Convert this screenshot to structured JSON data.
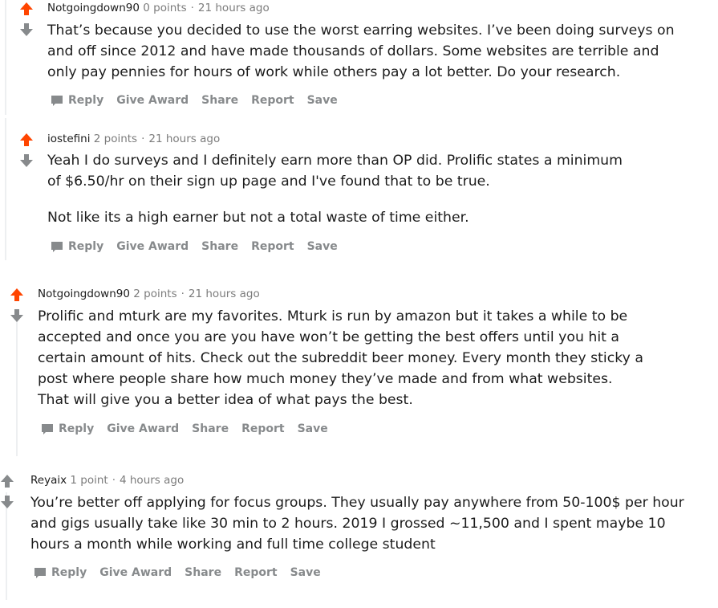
{
  "colors": {
    "upvote_active": "#ff4500",
    "vote_inactive": "#878a8c",
    "meta_text": "#7c7c7c",
    "action_text": "#878a8c"
  },
  "icons": {
    "upvote": "arrow-up-icon",
    "downvote": "arrow-down-icon",
    "reply": "speech-bubble-icon"
  },
  "actions": {
    "reply": "Reply",
    "give_award": "Give Award",
    "share": "Share",
    "report": "Report",
    "save": "Save"
  },
  "comments": [
    {
      "author": "Notgoingdown90",
      "points": "0 points",
      "sep": "·",
      "time": "21 hours ago",
      "upvoted": true,
      "paragraphs": [
        "That’s because you decided to use the worst earring websites. I’ve been doing surveys on and off since 2012 and have made thousands of dollars. Some websites are terrible and only pay pennies for hours of work while others pay a lot better. Do your research."
      ]
    },
    {
      "author": "iostefini",
      "points": "2 points",
      "sep": "·",
      "time": "21 hours ago",
      "upvoted": true,
      "paragraphs": [
        "Yeah I do surveys and I definitely earn more than OP did. Prolific states a minimum of $6.50/hr on their sign up page and I've found that to be true.",
        "Not like its a high earner but not a total waste of time either."
      ]
    },
    {
      "author": "Notgoingdown90",
      "points": "2 points",
      "sep": "·",
      "time": "21 hours ago",
      "upvoted": true,
      "paragraphs": [
        "Prolific and mturk are my favorites. Mturk is run by amazon but it takes a while to be accepted and once you are you have won’t be getting the best offers until you hit a certain amount of hits. Check out the subreddit beer money. Every month they sticky a post where people share how much money they’ve made and from what websites. That will give you a better idea of what pays the best."
      ]
    },
    {
      "author": "Reyaix",
      "points": "1 point",
      "sep": "·",
      "time": "4 hours ago",
      "upvoted": false,
      "paragraphs": [
        "You’re better off applying for focus groups. They usually pay anywhere from 50-100$ per hour and gigs usually take like 30 min to 2 hours. 2019 I grossed ~11,500 and I spent maybe 10 hours a month while working and full time college student"
      ]
    }
  ]
}
